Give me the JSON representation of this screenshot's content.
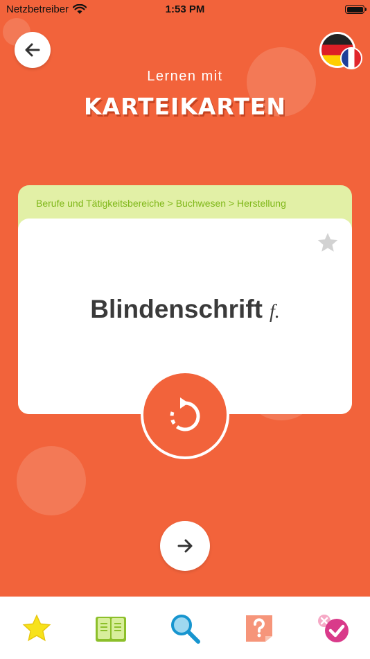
{
  "status_bar": {
    "carrier": "Netzbetreiber",
    "time": "1:53 PM"
  },
  "header": {
    "subtitle": "Lernen mit",
    "title": "KARTEIKARTEN",
    "back_icon": "arrow-left-icon",
    "language_flags": [
      "german-flag-icon",
      "french-flag-icon"
    ]
  },
  "card": {
    "breadcrumb": "Berufe und Tätigkeitsbereiche > Buchwesen > Herstellung",
    "term": "Blindenschrift",
    "gender": "f.",
    "favorite_icon": "star-icon"
  },
  "actions": {
    "flip_icon": "flip-rotate-icon",
    "next_icon": "arrow-right-icon"
  },
  "tab_bar": {
    "items": [
      "favorites-star-icon",
      "book-icon",
      "search-icon",
      "quiz-question-icon",
      "check-badge-icon"
    ]
  },
  "colors": {
    "background": "#F2633B",
    "card_header": "#E2F0A6",
    "breadcrumb": "#7FB719",
    "term_text": "#3A3A3A"
  }
}
